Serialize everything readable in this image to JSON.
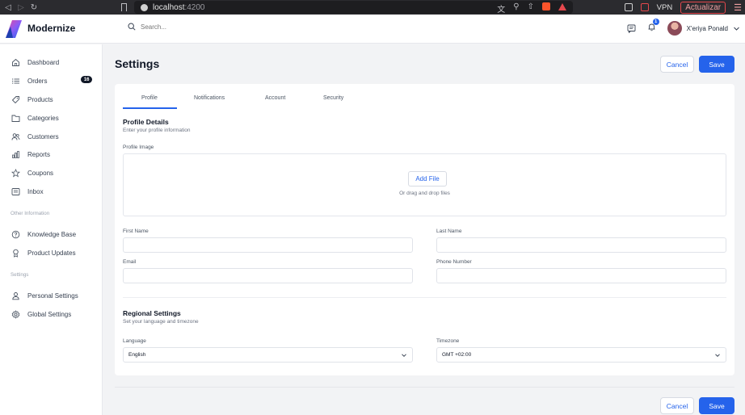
{
  "browser": {
    "url_host": "localhost",
    "url_port": ":4200",
    "vpn_label": "VPN",
    "update_label": "Actualizar"
  },
  "header": {
    "brand": "Modernize",
    "search_placeholder": "Search...",
    "notification_count": "1",
    "user_name": "X'eriya Ponald"
  },
  "sidebar": {
    "items": [
      {
        "label": "Dashboard",
        "icon": "home-icon"
      },
      {
        "label": "Orders",
        "icon": "list-icon",
        "badge": "16"
      },
      {
        "label": "Products",
        "icon": "tag-icon"
      },
      {
        "label": "Categories",
        "icon": "folder-icon"
      },
      {
        "label": "Customers",
        "icon": "users-icon"
      },
      {
        "label": "Reports",
        "icon": "bar-chart-icon"
      },
      {
        "label": "Coupons",
        "icon": "star-icon"
      },
      {
        "label": "Inbox",
        "icon": "inbox-icon"
      }
    ],
    "other_section": "Other Information",
    "other_items": [
      {
        "label": "Knowledge Base",
        "icon": "help-circle-icon"
      },
      {
        "label": "Product Updates",
        "icon": "award-icon"
      }
    ],
    "settings_section": "Settings",
    "settings_items": [
      {
        "label": "Personal Settings",
        "icon": "user-icon"
      },
      {
        "label": "Global Settings",
        "icon": "gear-icon"
      }
    ]
  },
  "page": {
    "title": "Settings",
    "cancel_label": "Cancel",
    "save_label": "Save"
  },
  "tabs": [
    "Profile",
    "Notifications",
    "Account",
    "Security"
  ],
  "profile": {
    "title": "Profile Details",
    "subtitle": "Enter your profile information",
    "image_label": "Profile Image",
    "add_file_label": "Add File",
    "drop_hint": "Or drag and drop files",
    "first_name_label": "First Name",
    "first_name_value": "",
    "last_name_label": "Last Name",
    "last_name_value": "",
    "email_label": "Email",
    "email_value": "",
    "phone_label": "Phone Number",
    "phone_value": ""
  },
  "regional": {
    "title": "Regional Settings",
    "subtitle": "Set your language and timezone",
    "language_label": "Language",
    "language_value": "English",
    "timezone_label": "Timezone",
    "timezone_value": "GMT +02:00"
  },
  "colors": {
    "accent": "#2563eb",
    "background": "#f2f3f5"
  }
}
